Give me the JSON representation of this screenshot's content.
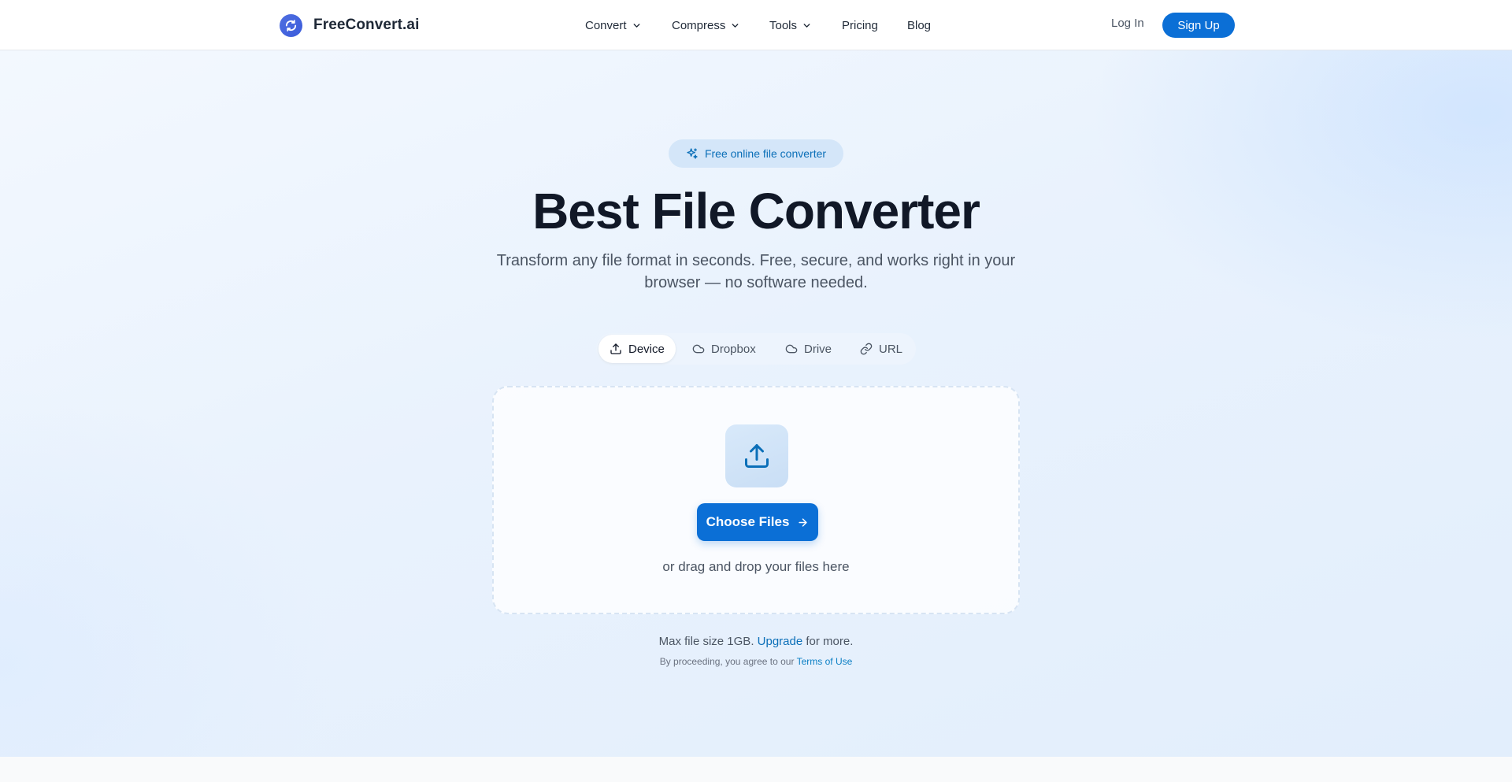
{
  "header": {
    "brand": "FreeConvert.ai",
    "nav": {
      "convert": "Convert",
      "compress": "Compress",
      "tools": "Tools",
      "pricing": "Pricing",
      "blog": "Blog"
    },
    "login": "Log In",
    "signup": "Sign Up"
  },
  "hero": {
    "badge": "Free online file converter",
    "title": "Best File Converter",
    "subtitle": "Transform any file format in seconds. Free, secure, and works right in your browser — no software needed.",
    "tabs": [
      "Device",
      "Dropbox",
      "Drive",
      "URL"
    ],
    "active_tab": "Device",
    "choose_button": "Choose Files",
    "drag_text": "or drag and drop your files here",
    "max_prefix": "Max file size 1GB.",
    "max_link": "Upgrade",
    "max_suffix": "for more.",
    "terms_prefix": "By proceeding, you agree to our",
    "terms_link": "Terms of Use"
  },
  "colors": {
    "accent": "#0b6fd6",
    "badge_bg": "#d4e6f9",
    "link": "#0b6fb8"
  },
  "icons": {
    "logo": "refresh-circle-icon",
    "badge": "sparkles-icon",
    "device": "upload-icon",
    "dropbox": "cloud-icon",
    "drive": "cloud-icon",
    "url": "link-icon",
    "upload_tile": "upload-icon",
    "choose": "arrow-right-icon",
    "dropdown": "chevron-down-icon"
  }
}
